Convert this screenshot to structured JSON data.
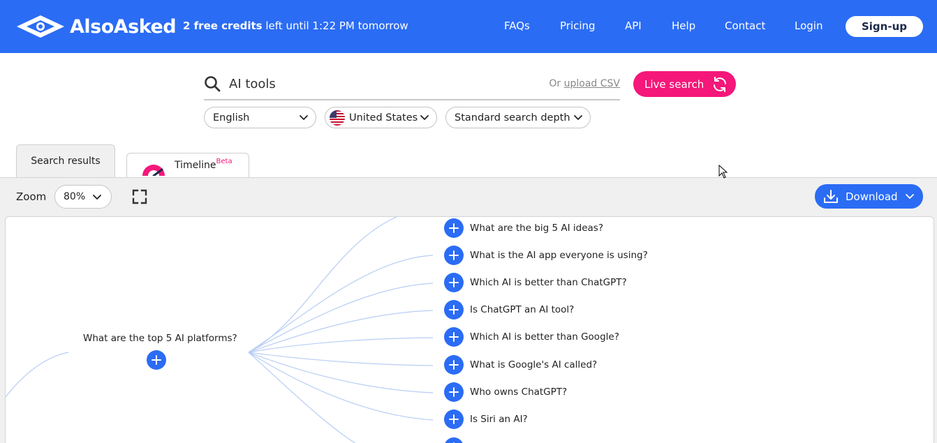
{
  "header": {
    "logo_text": "AlsoAsked",
    "credits_bold": "2 free credits",
    "credits_rest": "left until 1:22 PM tomorrow",
    "nav": [
      "FAQs",
      "Pricing",
      "API",
      "Help",
      "Contact",
      "Login"
    ],
    "signup": "Sign-up"
  },
  "search": {
    "value": "AI tools",
    "or_text": "Or",
    "upload_link": "upload CSV",
    "live_button": "Live search"
  },
  "filters": {
    "language": "English",
    "region": "United States",
    "depth": "Standard search depth"
  },
  "tabs": {
    "search_results": "Search results",
    "timeline": "Timeline",
    "beta": "Beta"
  },
  "toolbar": {
    "zoom_label": "Zoom",
    "zoom_value": "80%",
    "download": "Download"
  },
  "tree": {
    "root_question": "What are the top 5 AI platforms?",
    "children": [
      "What are the big 5 AI ideas?",
      "What is the AI app everyone is using?",
      "Which AI is better than ChatGPT?",
      "Is ChatGPT an AI tool?",
      "Which AI is better than Google?",
      "What is Google's AI called?",
      "Who owns ChatGPT?",
      "Is Siri an AI?"
    ]
  },
  "colors": {
    "brand_blue": "#2b6cf5",
    "accent_pink": "#f5177a",
    "link_line": "#b9cdf5"
  }
}
